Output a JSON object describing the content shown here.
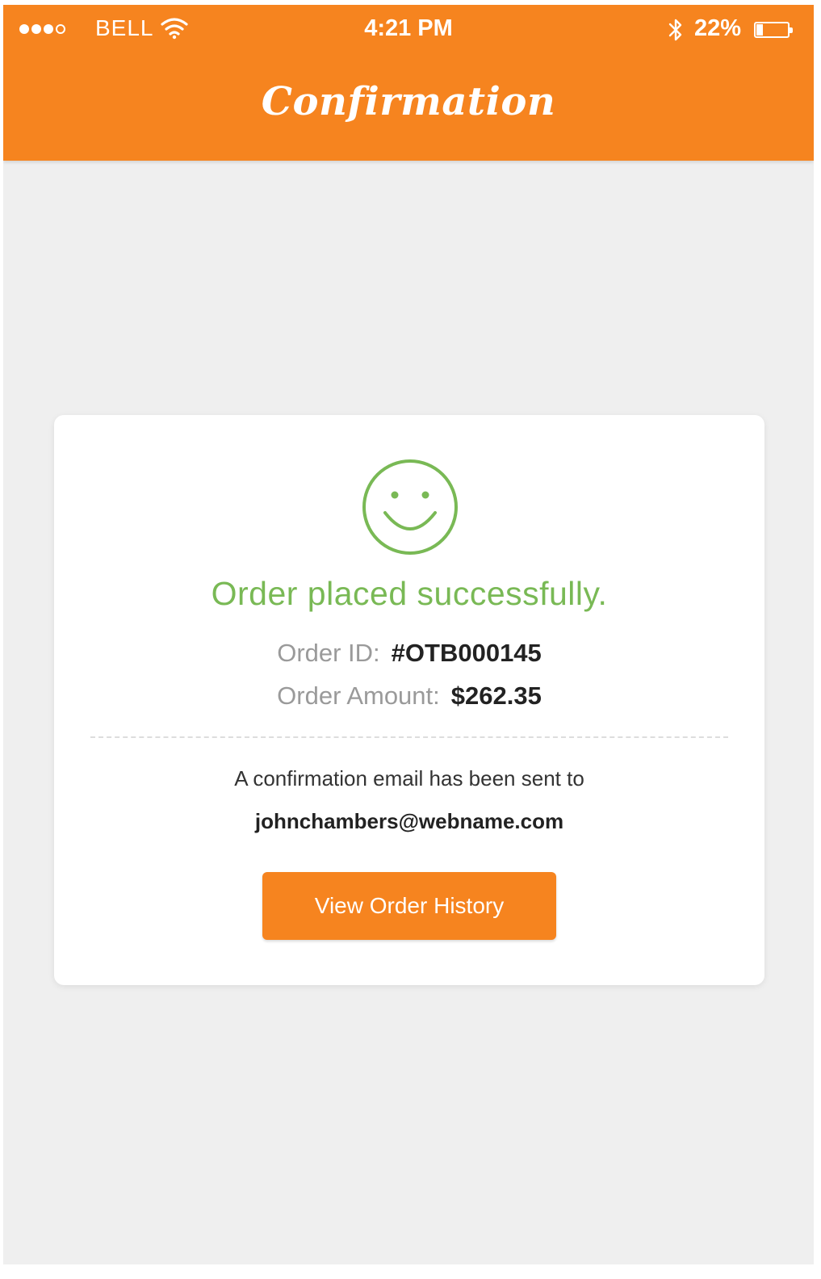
{
  "status_bar": {
    "carrier": "BELL",
    "time": "4:21 PM",
    "battery_percent": "22%",
    "signal_bars_filled": 3,
    "signal_bars_total": 4
  },
  "header": {
    "title": "Confirmation"
  },
  "confirmation": {
    "icon": "smiley-icon",
    "message": "Order placed successfully.",
    "order_id_label": "Order ID:",
    "order_id": "#OTB000145",
    "order_amount_label": "Order Amount:",
    "order_amount": "$262.35",
    "email_message": "A confirmation email has been sent to",
    "email": "johnchambers@webname.com",
    "button_label": "View Order History"
  },
  "colors": {
    "accent": "#f6841f",
    "success": "#79b955",
    "background": "#efefef"
  }
}
